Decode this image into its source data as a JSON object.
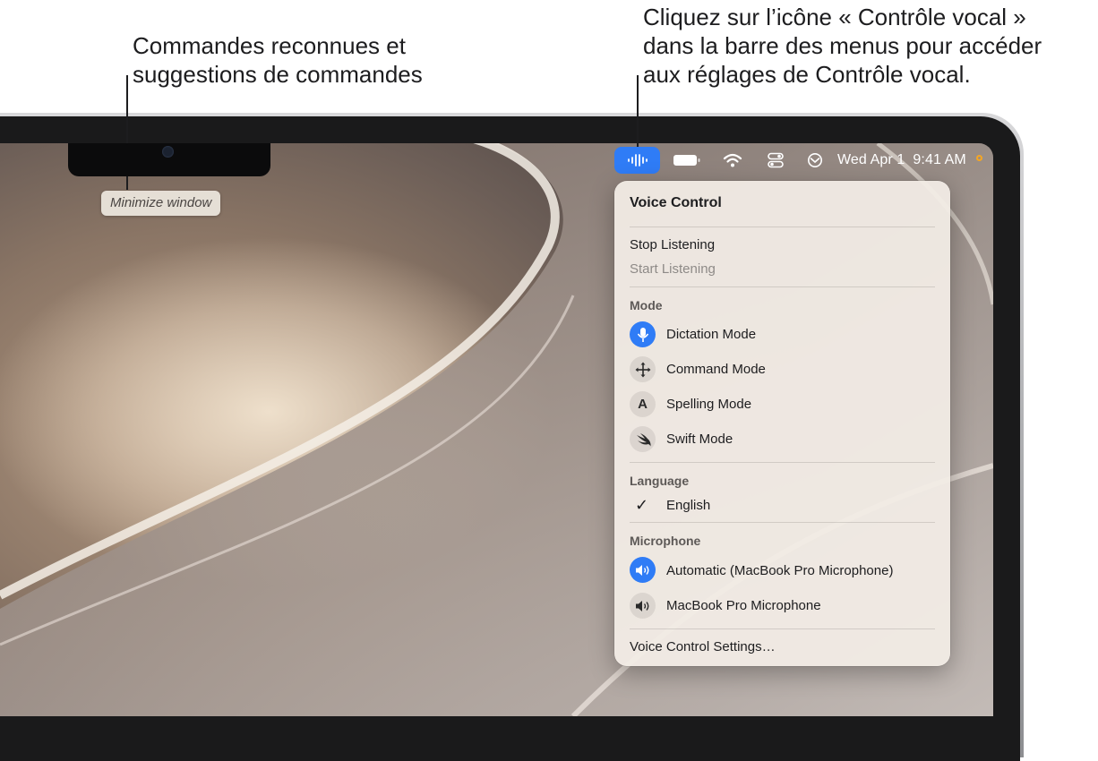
{
  "callouts": {
    "left": {
      "line1": "Commandes reconnues et",
      "line2": "suggestions de commandes"
    },
    "right": {
      "line1": "Cliquez sur l’icône « Contrôle vocal »",
      "line2": "dans la barre des menus pour accéder",
      "line3": "aux réglages de Contrôle vocal."
    }
  },
  "tooltip": {
    "text": "Minimize window"
  },
  "menubar": {
    "icons": [
      "voice-control-icon",
      "battery-icon",
      "wifi-icon",
      "control-center-icon",
      "screen-mirroring-icon"
    ],
    "date": "Wed Apr 1",
    "time": "9:41 AM",
    "accent": "#2f7cf6",
    "indicator_color": "#f5a623"
  },
  "menu": {
    "title": "Voice Control",
    "stop": "Stop Listening",
    "start": "Start Listening",
    "mode_header": "Mode",
    "modes": [
      {
        "label": "Dictation Mode",
        "icon": "microphone-icon",
        "selected": true
      },
      {
        "label": "Command Mode",
        "icon": "move-arrows-icon",
        "selected": false
      },
      {
        "label": "Spelling Mode",
        "icon": "letter-a-icon",
        "glyph": "A",
        "selected": false
      },
      {
        "label": "Swift Mode",
        "icon": "swift-icon",
        "selected": false
      }
    ],
    "language_header": "Language",
    "language": "English",
    "microphone_header": "Microphone",
    "microphones": [
      {
        "label": "Automatic (MacBook Pro Microphone)",
        "icon": "speaker-icon",
        "selected": true
      },
      {
        "label": "MacBook Pro Microphone",
        "icon": "speaker-icon",
        "selected": false
      }
    ],
    "settings": "Voice Control Settings…"
  }
}
